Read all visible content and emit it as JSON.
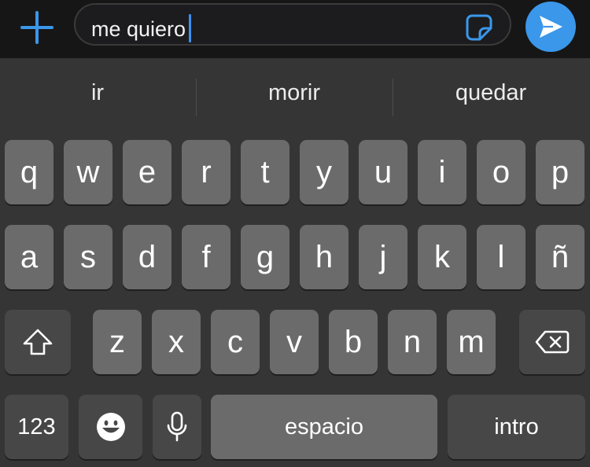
{
  "composer": {
    "text": "me quiero",
    "plus_icon": "plus-icon",
    "sticker_icon": "sticker-icon",
    "send_icon": "send-arrow-icon",
    "accent_color": "#3a97ea"
  },
  "suggestions": [
    "ir",
    "morir",
    "quedar"
  ],
  "keyboard": {
    "row1": [
      "q",
      "w",
      "e",
      "r",
      "t",
      "y",
      "u",
      "i",
      "o",
      "p"
    ],
    "row2": [
      "a",
      "s",
      "d",
      "f",
      "g",
      "h",
      "j",
      "k",
      "l",
      "ñ"
    ],
    "row3": [
      "z",
      "x",
      "c",
      "v",
      "b",
      "n",
      "m"
    ],
    "shift_icon": "shift-icon",
    "delete_icon": "backspace-icon",
    "numbers_label": "123",
    "emoji_icon": "emoji-icon",
    "mic_icon": "microphone-icon",
    "space_label": "espacio",
    "return_label": "intro"
  }
}
